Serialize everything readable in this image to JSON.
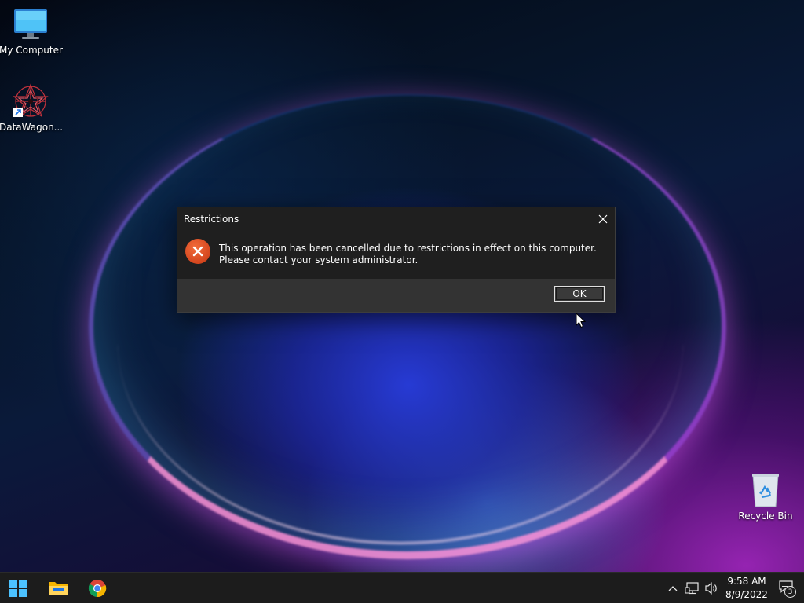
{
  "desktop": {
    "icons": [
      {
        "label": "My Computer",
        "icon": "monitor-icon"
      },
      {
        "label": "DataWagon...",
        "icon": "datawagon-app-icon",
        "shortcut": true
      },
      {
        "label": "Recycle Bin",
        "icon": "recycle-bin-icon"
      }
    ]
  },
  "dialog": {
    "title": "Restrictions",
    "message": "This operation has been cancelled due to restrictions in effect on this computer. Please contact your system administrator.",
    "ok_label": "OK",
    "icon": "error-icon",
    "close_icon": "close-icon"
  },
  "taskbar": {
    "pinned": [
      {
        "name": "start",
        "icon": "windows-start-icon"
      },
      {
        "name": "file-explorer",
        "icon": "folder-icon"
      },
      {
        "name": "chrome",
        "icon": "chrome-icon"
      }
    ],
    "tray": {
      "time": "9:58 AM",
      "date": "8/9/2022",
      "notification_count": "3"
    }
  },
  "colors": {
    "error_red": "#d4461e",
    "dialog_bg": "#1f1f1f",
    "dialog_footer": "#333333",
    "taskbar_bg": "#1c1c1c"
  }
}
